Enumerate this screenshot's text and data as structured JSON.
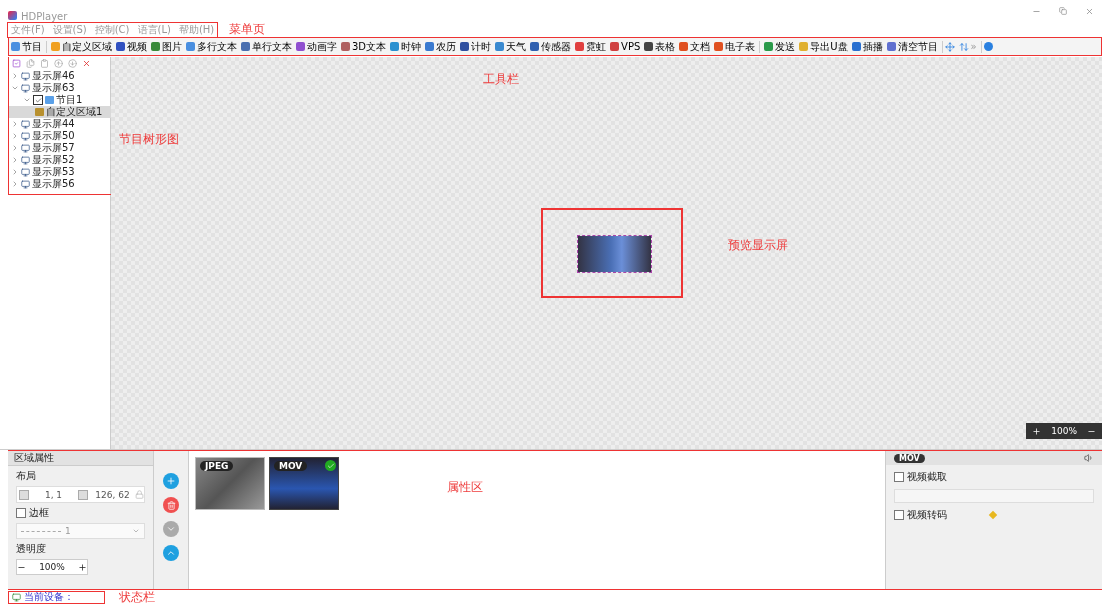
{
  "window": {
    "title": "HDPlayer"
  },
  "menu": {
    "items": [
      "文件(F)",
      "设置(S)",
      "控制(C)",
      "语言(L)",
      "帮助(H)"
    ],
    "annotation": "菜单页"
  },
  "toolbar": {
    "annotation": "工具栏",
    "groups": [
      [
        "节目"
      ],
      [
        "自定义区域",
        "视频",
        "图片",
        "多行文本",
        "单行文本",
        "动画字",
        "3D文本",
        "时钟",
        "农历",
        "计时",
        "天气",
        "传感器",
        "霓虹",
        "VPS",
        "表格",
        "文档",
        "电子表"
      ],
      [
        "发送",
        "导出U盘",
        "插播",
        "清空节目"
      ]
    ],
    "overflow": "»"
  },
  "tree": {
    "annotation": "节目树形图",
    "items": [
      {
        "kind": "screen",
        "label": "显示屏46",
        "expanded": false,
        "selected": false
      },
      {
        "kind": "screen",
        "label": "显示屏63",
        "expanded": true,
        "selected": false,
        "children": [
          {
            "kind": "program",
            "label": "节目1",
            "expanded": true,
            "checked": true,
            "selected": false,
            "children": [
              {
                "kind": "area",
                "label": "自定义区域1",
                "selected": true
              }
            ]
          }
        ]
      },
      {
        "kind": "screen",
        "label": "显示屏44",
        "expanded": false,
        "selected": false
      },
      {
        "kind": "screen",
        "label": "显示屏50",
        "expanded": false,
        "selected": false
      },
      {
        "kind": "screen",
        "label": "显示屏57",
        "expanded": false,
        "selected": false
      },
      {
        "kind": "screen",
        "label": "显示屏52",
        "expanded": false,
        "selected": false
      },
      {
        "kind": "screen",
        "label": "显示屏53",
        "expanded": false,
        "selected": false
      },
      {
        "kind": "screen",
        "label": "显示屏56",
        "expanded": false,
        "selected": false
      }
    ]
  },
  "preview": {
    "annotation": "预览显示屏",
    "zoom": "100%"
  },
  "properties": {
    "annotation": "属性区",
    "title": "区域属性",
    "layout_label": "布局",
    "position": "1, 1",
    "size": "126, 62",
    "border": {
      "label": "边框",
      "checked": false
    },
    "border_value": "1",
    "opacity_label": "透明度",
    "opacity": "100%",
    "media": [
      {
        "badge": "JPEG",
        "selected": false
      },
      {
        "badge": "MOV",
        "selected": true
      }
    ],
    "detail": {
      "badge": "MOV",
      "options": [
        {
          "label": "视频截取",
          "checked": false
        },
        {
          "label": "视频转码",
          "checked": false
        }
      ]
    }
  },
  "status": {
    "annotation": "状态栏",
    "text": "当前设备："
  }
}
